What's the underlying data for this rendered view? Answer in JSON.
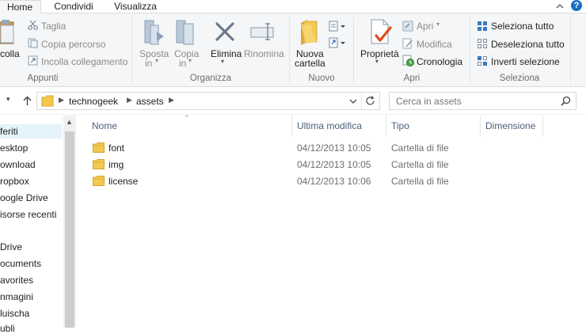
{
  "tabs": {
    "home": "Home",
    "share": "Condividi",
    "view": "Visualizza",
    "help": "?"
  },
  "ribbon": {
    "clipboard": {
      "paste_partial": "colla",
      "cut": "Taglia",
      "copy_path": "Copia percorso",
      "paste_shortcut": "Incolla collegamento",
      "group": "Appunti"
    },
    "organize": {
      "move_l1": "Sposta",
      "move_l2": "in",
      "copy_l1": "Copia",
      "copy_l2": "in",
      "delete": "Elimina",
      "rename": "Rinomina",
      "group": "Organizza"
    },
    "new": {
      "folder_l1": "Nuova",
      "folder_l2": "cartella",
      "group": "Nuovo"
    },
    "open": {
      "properties": "Proprietà",
      "open": "Apri",
      "edit": "Modifica",
      "history": "Cronologia",
      "group": "Apri"
    },
    "select": {
      "select_all": "Seleziona tutto",
      "deselect_all": "Deseleziona tutto",
      "invert": "Inverti selezione",
      "group": "Seleziona"
    }
  },
  "address": {
    "crumbs": [
      "technogeek",
      "assets"
    ]
  },
  "search": {
    "placeholder": "Cerca in assets"
  },
  "nav": {
    "items": [
      "feriti",
      "esktop",
      "ownload",
      "ropbox",
      "oogle Drive",
      "isorse recenti",
      "Drive",
      "ocuments",
      "avorites",
      "nmagini",
      "luischa",
      "ubli"
    ]
  },
  "columns": {
    "name": "Nome",
    "modified": "Ultima modifica",
    "type": "Tipo",
    "size": "Dimensione"
  },
  "files": [
    {
      "name": "font",
      "modified": "04/12/2013 10:05",
      "type": "Cartella di file"
    },
    {
      "name": "img",
      "modified": "04/12/2013 10:05",
      "type": "Cartella di file"
    },
    {
      "name": "license",
      "modified": "04/12/2013 10:06",
      "type": "Cartella di file"
    }
  ],
  "colors": {
    "accent": "#1a6fc4",
    "folder": "#e8b84a",
    "selection": "#e5f3fb"
  }
}
